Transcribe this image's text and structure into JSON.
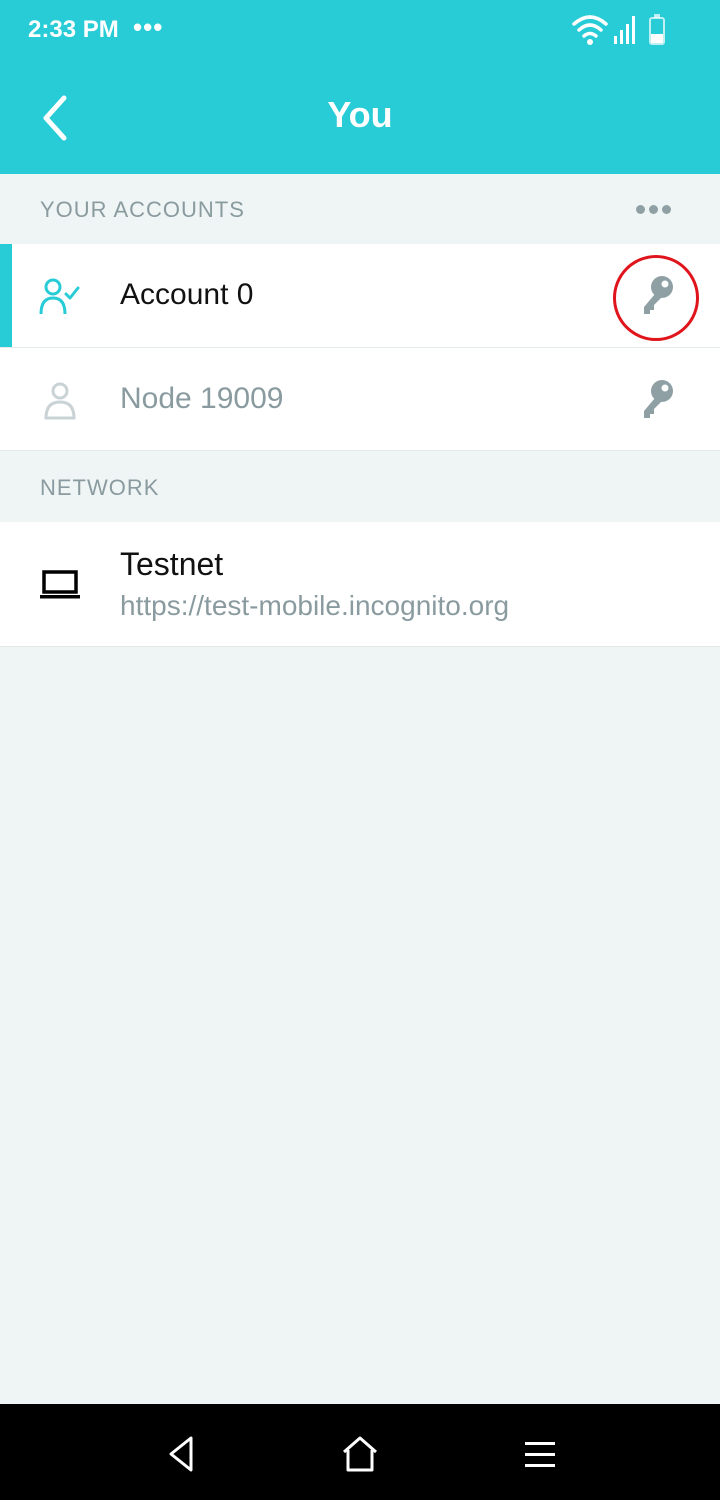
{
  "status_bar": {
    "time": "2:33 PM",
    "more_dots": "•••"
  },
  "header": {
    "title": "You",
    "back_icon": "chevron-left-icon"
  },
  "accounts_section": {
    "label": "YOUR ACCOUNTS",
    "more_icon": "more-horizontal-icon",
    "items": [
      {
        "label": "Account 0",
        "icon": "user-check-icon",
        "action_icon": "key-icon",
        "active": true
      },
      {
        "label": "Node 19009",
        "icon": "user-icon",
        "action_icon": "key-icon",
        "active": false
      }
    ]
  },
  "network_section": {
    "label": "NETWORK",
    "item": {
      "title": "Testnet",
      "url": "https://test-mobile.incognito.org",
      "icon": "laptop-icon"
    }
  },
  "colors": {
    "accent": "#27ccd7",
    "background": "#eff4f4",
    "muted_text": "#8a9ba0",
    "key_icon": "#8fa0a5",
    "highlight_ring": "#e0141b"
  },
  "nav_bar": {
    "icons": [
      "back-triangle-icon",
      "home-icon",
      "menu-icon"
    ]
  }
}
